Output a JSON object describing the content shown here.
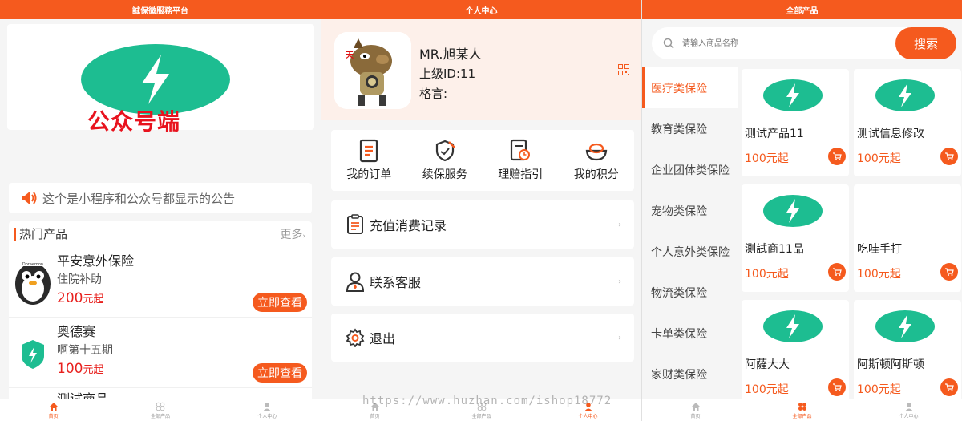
{
  "colors": {
    "accent": "#f55a1e",
    "price": "#e8211e",
    "brand_green": "#1dbd91"
  },
  "panel1": {
    "title": "誠保微服務平台",
    "banner_text": "公众号端",
    "notice": "这个是小程序和公众号都显示的公告",
    "hot_title": "热门产品",
    "hot_more": "更多",
    "products": [
      {
        "name": "平安意外保险",
        "desc": "住院补助",
        "price": "200",
        "unit": "元起",
        "btn": "立即查看"
      },
      {
        "name": "奥德赛",
        "desc": "啊第十五期",
        "price": "100",
        "unit": "元起",
        "btn": "立即查看"
      }
    ],
    "product3_name": "测试商品"
  },
  "panel2": {
    "title": "个人中心",
    "user_name": "MR.旭某人",
    "level": "上级ID:11",
    "motto": "格言:",
    "grid": [
      "我的订单",
      "续保服务",
      "理赔指引",
      "我的积分"
    ],
    "rows": [
      "充值消费记录",
      "联系客服",
      "退出"
    ]
  },
  "panel3": {
    "title": "全部产品",
    "search_placeholder": "请输入商品名称",
    "search_btn": "搜索",
    "categories": [
      "医疗类保险",
      "教育类保险",
      "企业团体类保险",
      "宠物类保险",
      "个人意外类保险",
      "物流类保险",
      "卡单类保险",
      "家财类保险"
    ],
    "products": [
      {
        "name": "测试产品11",
        "price": "100元起",
        "logo": true
      },
      {
        "name": "测试信息修改",
        "price": "100元起",
        "logo": true
      },
      {
        "name": "測試商11品",
        "price": "100元起",
        "logo": true
      },
      {
        "name": "吃哇手打",
        "price": "100元起",
        "logo": false
      },
      {
        "name": "阿薩大大",
        "price": "100元起",
        "logo": true
      },
      {
        "name": "阿斯顿阿斯顿",
        "price": "100元起",
        "logo": true
      }
    ]
  },
  "tabbar": [
    "首页",
    "全部产品",
    "个人中心"
  ],
  "watermark": "https://www.huzhan.com/ishop18772"
}
